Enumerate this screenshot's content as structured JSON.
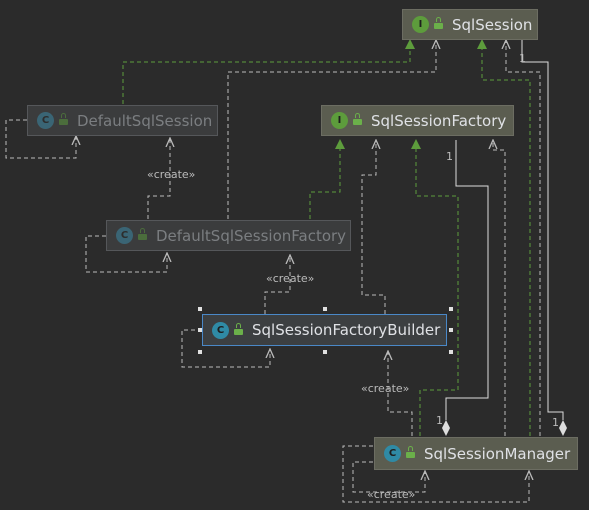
{
  "nodes": {
    "sql_session": {
      "name": "SqlSession",
      "kind": "I"
    },
    "default_sql_session": {
      "name": "DefaultSqlSession",
      "kind": "C"
    },
    "sql_session_factory": {
      "name": "SqlSessionFactory",
      "kind": "I"
    },
    "default_sql_session_factory": {
      "name": "DefaultSqlSessionFactory",
      "kind": "C"
    },
    "sql_session_factory_builder": {
      "name": "SqlSessionFactoryBuilder",
      "kind": "C"
    },
    "sql_session_manager": {
      "name": "SqlSessionManager",
      "kind": "C"
    }
  },
  "edge_labels": {
    "create": "«create»",
    "multiplicity": "1"
  },
  "colors": {
    "background": "#2b2b2b",
    "implements": "#5d9c3c",
    "dependency": "#bbbbbb",
    "selection": "#4a88c7"
  }
}
